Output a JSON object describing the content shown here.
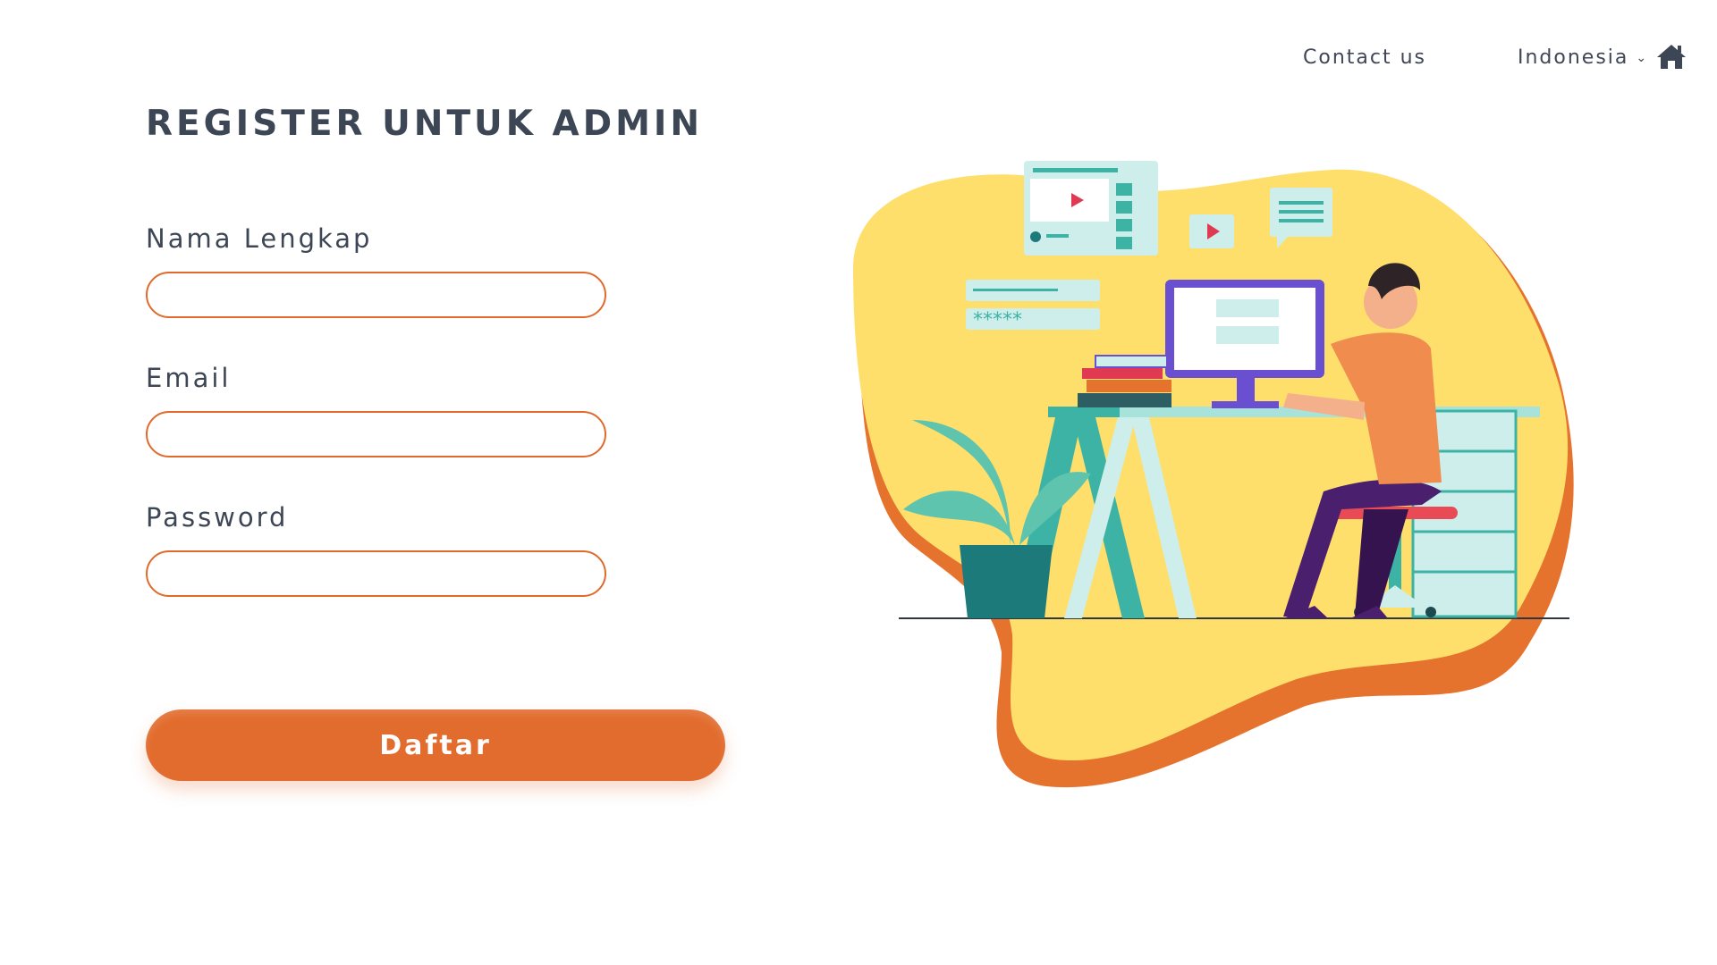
{
  "nav": {
    "contact": "Contact us",
    "language": "Indonesia",
    "home_icon": "home-icon"
  },
  "page": {
    "title": "REGISTER UNTUK ADMIN"
  },
  "form": {
    "fields": [
      {
        "label": "Nama Lengkap",
        "value": "",
        "placeholder": ""
      },
      {
        "label": "Email",
        "value": "",
        "placeholder": ""
      },
      {
        "label": "Password",
        "value": "",
        "placeholder": ""
      }
    ],
    "submit_label": "Daftar"
  },
  "illustration": {
    "screen_password_mask": "*****"
  },
  "colors": {
    "accent": "#e26c2e",
    "text": "#3d4655",
    "blob": "#ffdf6b",
    "blob_shadow": "#e5722d",
    "teal": "#3db3a6"
  }
}
